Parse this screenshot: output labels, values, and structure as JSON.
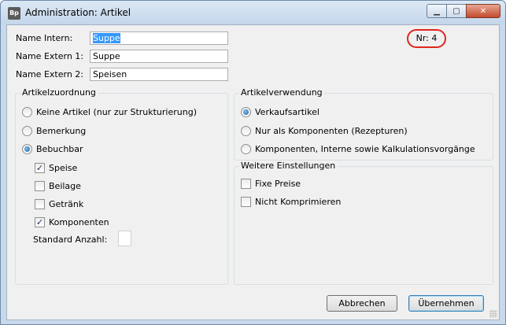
{
  "window": {
    "app_icon": "Bp",
    "title": "Administration: Artikel",
    "buttons": {
      "minimize": "minimize-icon",
      "maximize": "maximize-icon",
      "close": "close-icon"
    }
  },
  "fields": {
    "name_intern": {
      "label": "Name Intern:",
      "value": "Suppe"
    },
    "name_extern_1": {
      "label": "Name Extern 1:",
      "value": "Suppe"
    },
    "name_extern_2": {
      "label": "Name Extern 2:",
      "value": "Speisen"
    },
    "nr": "Nr: 4"
  },
  "artikelzuordnung": {
    "title": "Artikelzuordnung",
    "radios": [
      {
        "label": "Keine Artikel (nur zur Strukturierung)",
        "checked": false
      },
      {
        "label": "Bemerkung",
        "checked": false
      },
      {
        "label": "Bebuchbar",
        "checked": true
      }
    ],
    "checkboxes": [
      {
        "label": "Speise",
        "checked": true
      },
      {
        "label": "Beilage",
        "checked": false
      },
      {
        "label": "Getränk",
        "checked": false
      },
      {
        "label": "Komponenten",
        "checked": true
      }
    ],
    "standard_anzahl": {
      "label": "Standard Anzahl:",
      "value": ""
    }
  },
  "artikelverwendung": {
    "title": "Artikelverwendung",
    "radios": [
      {
        "label": "Verkaufsartikel",
        "checked": true
      },
      {
        "label": "Nur als Komponenten (Rezepturen)",
        "checked": false
      },
      {
        "label": "Komponenten, Interne sowie Kalkulationsvorgänge",
        "checked": false
      }
    ]
  },
  "weitere": {
    "title": "Weitere Einstellungen",
    "checkboxes": [
      {
        "label": "Fixe Preise",
        "checked": false
      },
      {
        "label": "Nicht Komprimieren",
        "checked": false
      }
    ]
  },
  "footer": {
    "cancel": "Abbrechen",
    "ok": "Übernehmen"
  },
  "colors": {
    "highlight": "#e0261d",
    "selection": "#3399ff"
  }
}
